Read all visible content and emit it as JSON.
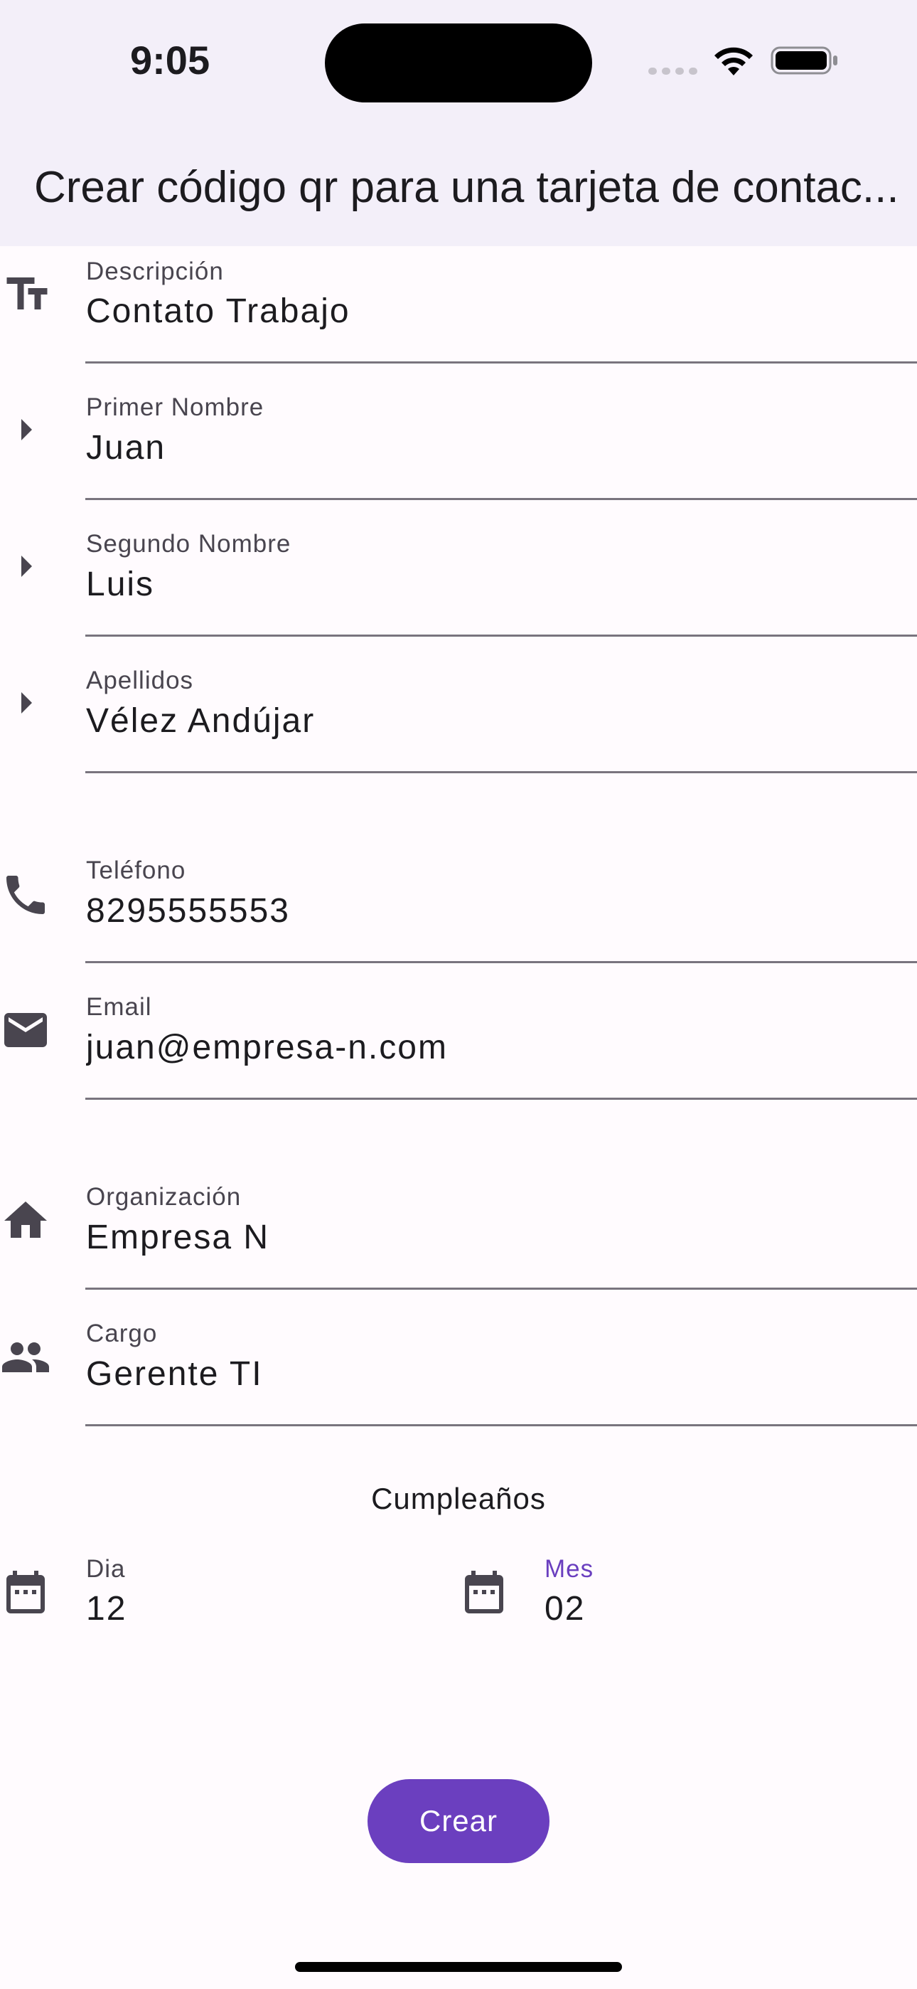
{
  "status_bar": {
    "time": "9:05"
  },
  "app_bar": {
    "title": "Crear código qr para una tarjeta de contac..."
  },
  "fields": {
    "descripcion": {
      "label": "Descripción",
      "value": "Contato Trabajo",
      "icon": "text-fields-icon"
    },
    "primer_nombre": {
      "label": "Primer Nombre",
      "value": "Juan",
      "icon": "arrow-right-icon"
    },
    "segundo_nombre": {
      "label": "Segundo Nombre",
      "value": "Luis",
      "icon": "arrow-right-icon"
    },
    "apellidos": {
      "label": "Apellidos",
      "value": "Vélez Andújar",
      "icon": "arrow-right-icon"
    },
    "telefono": {
      "label": "Teléfono",
      "value": "8295555553",
      "icon": "phone-icon"
    },
    "email": {
      "label": "Email",
      "value": "juan@empresa-n.com",
      "icon": "email-icon"
    },
    "organizacion": {
      "label": "Organización",
      "value": "Empresa N",
      "icon": "home-icon"
    },
    "cargo": {
      "label": "Cargo",
      "value": "Gerente TI",
      "icon": "people-icon"
    }
  },
  "birthday": {
    "title": "Cumpleaños",
    "dia": {
      "label": "Dia",
      "value": "12",
      "icon": "calendar-icon"
    },
    "mes": {
      "label": "Mes",
      "value": "02",
      "icon": "calendar-icon"
    }
  },
  "actions": {
    "create_label": "Crear"
  },
  "colors": {
    "accent": "#6b3fbf",
    "app_bar_bg": "#f3eff9",
    "page_bg": "#fffbfe",
    "icon": "#49454f"
  }
}
